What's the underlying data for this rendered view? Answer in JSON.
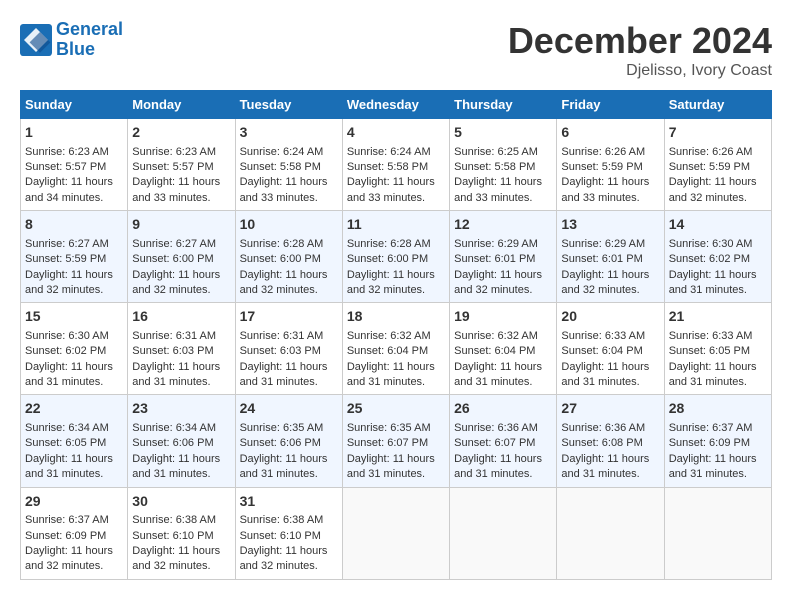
{
  "header": {
    "logo_line1": "General",
    "logo_line2": "Blue",
    "month_title": "December 2024",
    "location": "Djelisso, Ivory Coast"
  },
  "days_of_week": [
    "Sunday",
    "Monday",
    "Tuesday",
    "Wednesday",
    "Thursday",
    "Friday",
    "Saturday"
  ],
  "weeks": [
    [
      {
        "day": "1",
        "sunrise": "6:23 AM",
        "sunset": "5:57 PM",
        "daylight": "11 hours and 34 minutes."
      },
      {
        "day": "2",
        "sunrise": "6:23 AM",
        "sunset": "5:57 PM",
        "daylight": "11 hours and 33 minutes."
      },
      {
        "day": "3",
        "sunrise": "6:24 AM",
        "sunset": "5:58 PM",
        "daylight": "11 hours and 33 minutes."
      },
      {
        "day": "4",
        "sunrise": "6:24 AM",
        "sunset": "5:58 PM",
        "daylight": "11 hours and 33 minutes."
      },
      {
        "day": "5",
        "sunrise": "6:25 AM",
        "sunset": "5:58 PM",
        "daylight": "11 hours and 33 minutes."
      },
      {
        "day": "6",
        "sunrise": "6:26 AM",
        "sunset": "5:59 PM",
        "daylight": "11 hours and 33 minutes."
      },
      {
        "day": "7",
        "sunrise": "6:26 AM",
        "sunset": "5:59 PM",
        "daylight": "11 hours and 32 minutes."
      }
    ],
    [
      {
        "day": "8",
        "sunrise": "6:27 AM",
        "sunset": "5:59 PM",
        "daylight": "11 hours and 32 minutes."
      },
      {
        "day": "9",
        "sunrise": "6:27 AM",
        "sunset": "6:00 PM",
        "daylight": "11 hours and 32 minutes."
      },
      {
        "day": "10",
        "sunrise": "6:28 AM",
        "sunset": "6:00 PM",
        "daylight": "11 hours and 32 minutes."
      },
      {
        "day": "11",
        "sunrise": "6:28 AM",
        "sunset": "6:00 PM",
        "daylight": "11 hours and 32 minutes."
      },
      {
        "day": "12",
        "sunrise": "6:29 AM",
        "sunset": "6:01 PM",
        "daylight": "11 hours and 32 minutes."
      },
      {
        "day": "13",
        "sunrise": "6:29 AM",
        "sunset": "6:01 PM",
        "daylight": "11 hours and 32 minutes."
      },
      {
        "day": "14",
        "sunrise": "6:30 AM",
        "sunset": "6:02 PM",
        "daylight": "11 hours and 31 minutes."
      }
    ],
    [
      {
        "day": "15",
        "sunrise": "6:30 AM",
        "sunset": "6:02 PM",
        "daylight": "11 hours and 31 minutes."
      },
      {
        "day": "16",
        "sunrise": "6:31 AM",
        "sunset": "6:03 PM",
        "daylight": "11 hours and 31 minutes."
      },
      {
        "day": "17",
        "sunrise": "6:31 AM",
        "sunset": "6:03 PM",
        "daylight": "11 hours and 31 minutes."
      },
      {
        "day": "18",
        "sunrise": "6:32 AM",
        "sunset": "6:04 PM",
        "daylight": "11 hours and 31 minutes."
      },
      {
        "day": "19",
        "sunrise": "6:32 AM",
        "sunset": "6:04 PM",
        "daylight": "11 hours and 31 minutes."
      },
      {
        "day": "20",
        "sunrise": "6:33 AM",
        "sunset": "6:04 PM",
        "daylight": "11 hours and 31 minutes."
      },
      {
        "day": "21",
        "sunrise": "6:33 AM",
        "sunset": "6:05 PM",
        "daylight": "11 hours and 31 minutes."
      }
    ],
    [
      {
        "day": "22",
        "sunrise": "6:34 AM",
        "sunset": "6:05 PM",
        "daylight": "11 hours and 31 minutes."
      },
      {
        "day": "23",
        "sunrise": "6:34 AM",
        "sunset": "6:06 PM",
        "daylight": "11 hours and 31 minutes."
      },
      {
        "day": "24",
        "sunrise": "6:35 AM",
        "sunset": "6:06 PM",
        "daylight": "11 hours and 31 minutes."
      },
      {
        "day": "25",
        "sunrise": "6:35 AM",
        "sunset": "6:07 PM",
        "daylight": "11 hours and 31 minutes."
      },
      {
        "day": "26",
        "sunrise": "6:36 AM",
        "sunset": "6:07 PM",
        "daylight": "11 hours and 31 minutes."
      },
      {
        "day": "27",
        "sunrise": "6:36 AM",
        "sunset": "6:08 PM",
        "daylight": "11 hours and 31 minutes."
      },
      {
        "day": "28",
        "sunrise": "6:37 AM",
        "sunset": "6:09 PM",
        "daylight": "11 hours and 31 minutes."
      }
    ],
    [
      {
        "day": "29",
        "sunrise": "6:37 AM",
        "sunset": "6:09 PM",
        "daylight": "11 hours and 32 minutes."
      },
      {
        "day": "30",
        "sunrise": "6:38 AM",
        "sunset": "6:10 PM",
        "daylight": "11 hours and 32 minutes."
      },
      {
        "day": "31",
        "sunrise": "6:38 AM",
        "sunset": "6:10 PM",
        "daylight": "11 hours and 32 minutes."
      },
      null,
      null,
      null,
      null
    ]
  ]
}
